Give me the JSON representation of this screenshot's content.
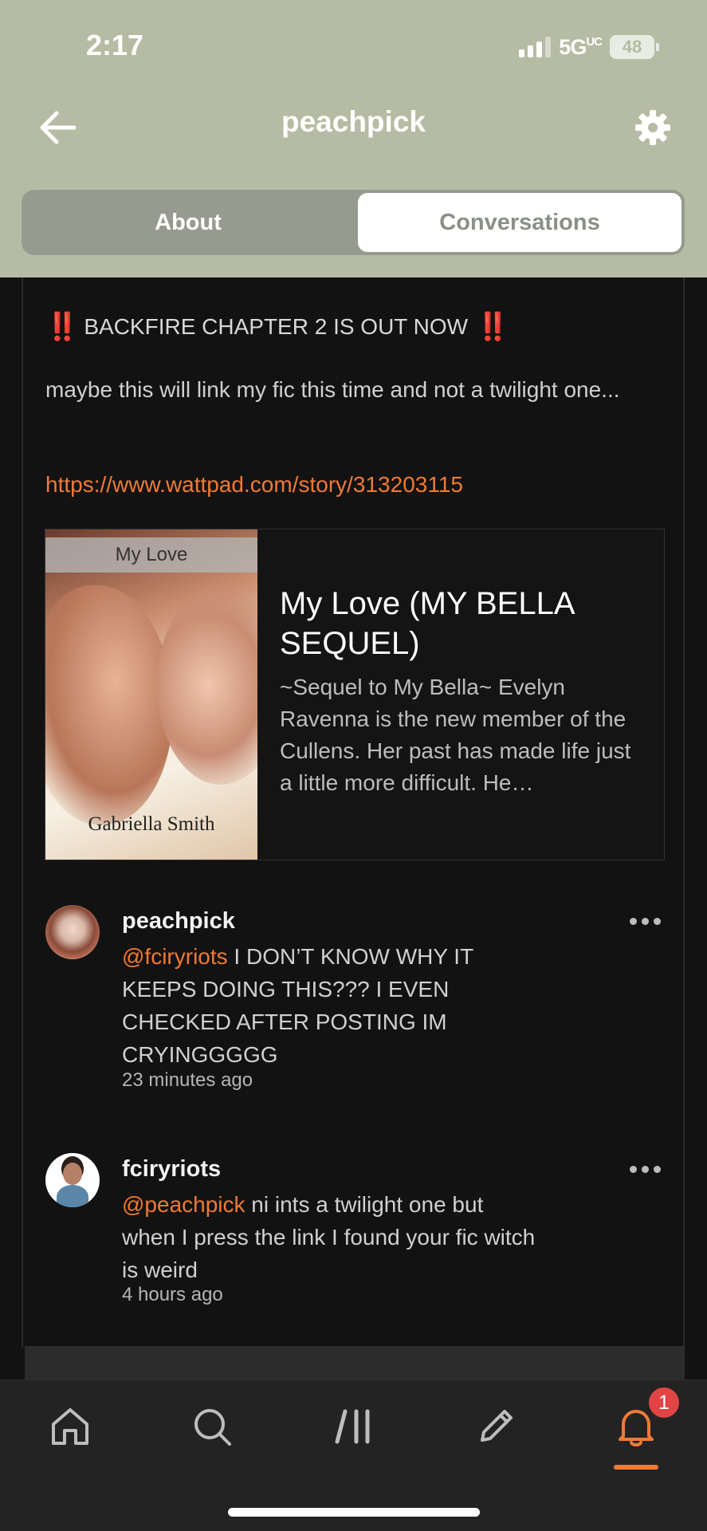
{
  "status_bar": {
    "time": "2:17",
    "network": "5G",
    "network_sub": "UC",
    "battery": "48"
  },
  "header": {
    "title": "peachpick",
    "back_icon": "arrow-left-icon",
    "settings_icon": "gear-icon"
  },
  "tabs": [
    {
      "label": "About",
      "active": false
    },
    {
      "label": "Conversations",
      "active": true
    }
  ],
  "post": {
    "headline_prefix": "‼️",
    "headline": "BACKFIRE CHAPTER 2 IS OUT NOW",
    "headline_suffix": "‼️",
    "body": "maybe this will link my fic this time and not a twilight one...",
    "link": "https://www.wattpad.com/story/313203115",
    "card": {
      "cover_title": "My Love",
      "cover_author": "Gabriella Smith",
      "title": "My Love (MY BELLA SEQUEL)",
      "description": "~Sequel to My Bella~  Evelyn Ravenna is the new member of the Cullens. Her past has made life just a little more difficult. He…"
    }
  },
  "comments": [
    {
      "username": "peachpick",
      "mention": "@fciryriots",
      "text": " I DON’T KNOW WHY IT KEEPS DOING THIS??? I EVEN CHECKED AFTER POSTING IM CRYINGGGGG",
      "time": "23 minutes ago"
    },
    {
      "username": "fciryriots",
      "mention": "@peachpick",
      "text": " ni ints a twilight one but when I press the link I found  your fic witch is weird",
      "time": "4 hours ago"
    }
  ],
  "bottom_nav": {
    "items": [
      "home-icon",
      "search-icon",
      "library-icon",
      "write-icon",
      "notifications-icon"
    ],
    "notification_count": "1",
    "accent": "#f07a35"
  }
}
